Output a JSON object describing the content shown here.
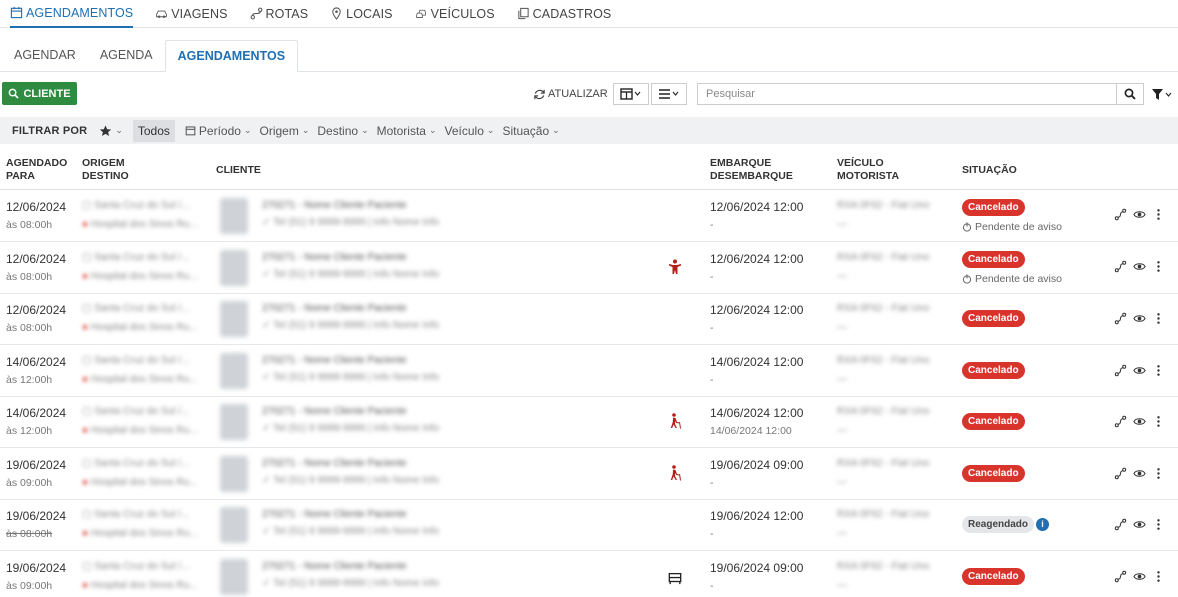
{
  "topnav": [
    {
      "label": "AGENDAMENTOS",
      "icon": "calendar-icon",
      "active": true
    },
    {
      "label": "VIAGENS",
      "icon": "car-icon",
      "active": false
    },
    {
      "label": "ROTAS",
      "icon": "route-icon",
      "active": false
    },
    {
      "label": "LOCAIS",
      "icon": "map-pin-icon",
      "active": false
    },
    {
      "label": "VEÍCULOS",
      "icon": "vehicles-icon",
      "active": false
    },
    {
      "label": "CADASTROS",
      "icon": "copy-icon",
      "active": false
    }
  ],
  "subtabs": [
    {
      "label": "AGENDAR",
      "active": false
    },
    {
      "label": "AGENDA",
      "active": false
    },
    {
      "label": "AGENDAMENTOS",
      "active": true
    }
  ],
  "toolbar": {
    "cliente_label": "CLIENTE",
    "atualizar_label": "ATUALIZAR",
    "search_placeholder": "Pesquisar"
  },
  "filterbar": {
    "label": "FILTRAR POR",
    "todos": "Todos",
    "items": [
      "Período",
      "Origem",
      "Destino",
      "Motorista",
      "Veículo",
      "Situação"
    ]
  },
  "columns": {
    "agendado": [
      "AGENDADO",
      "PARA"
    ],
    "origem": [
      "ORIGEM",
      "DESTINO"
    ],
    "cliente": "CLIENTE",
    "embarque": [
      "EMBARQUE",
      "DESEMBARQUE"
    ],
    "veiculo": [
      "VEÍCULO",
      "MOTORISTA"
    ],
    "situacao": "SITUAÇÃO"
  },
  "rows": [
    {
      "date": "12/06/2024",
      "hour": "às 08:00h",
      "emb": "12/06/2024 12:00",
      "desemb": "-",
      "status": "Cancelado",
      "status_type": "red",
      "pending": "Pendente de aviso",
      "special": ""
    },
    {
      "date": "12/06/2024",
      "hour": "às 08:00h",
      "emb": "12/06/2024 12:00",
      "desemb": "-",
      "status": "Cancelado",
      "status_type": "red",
      "pending": "Pendente de aviso",
      "special": "person-icon"
    },
    {
      "date": "12/06/2024",
      "hour": "às 08:00h",
      "emb": "12/06/2024 12:00",
      "desemb": "-",
      "status": "Cancelado",
      "status_type": "red",
      "pending": "",
      "special": ""
    },
    {
      "date": "14/06/2024",
      "hour": "às 12:00h",
      "emb": "14/06/2024 12:00",
      "desemb": "-",
      "status": "Cancelado",
      "status_type": "red",
      "pending": "",
      "special": ""
    },
    {
      "date": "14/06/2024",
      "hour": "às 12:00h",
      "emb": "14/06/2024 12:00",
      "desemb": "14/06/2024 12:00",
      "status": "Cancelado",
      "status_type": "red",
      "pending": "",
      "special": "walking-cane-icon"
    },
    {
      "date": "19/06/2024",
      "hour": "às 09:00h",
      "emb": "19/06/2024 09:00",
      "desemb": "-",
      "status": "Cancelado",
      "status_type": "red",
      "pending": "",
      "special": "walking-cane-icon"
    },
    {
      "date": "19/06/2024",
      "hour": "às 08:00h",
      "emb": "19/06/2024 12:00",
      "desemb": "-",
      "status": "Reagendado",
      "status_type": "grey",
      "pending": "",
      "special": ""
    },
    {
      "date": "19/06/2024",
      "hour": "às 09:00h",
      "emb": "19/06/2024 09:00",
      "desemb": "-",
      "status": "Cancelado",
      "status_type": "red",
      "pending": "",
      "special": "bed-icon"
    }
  ]
}
